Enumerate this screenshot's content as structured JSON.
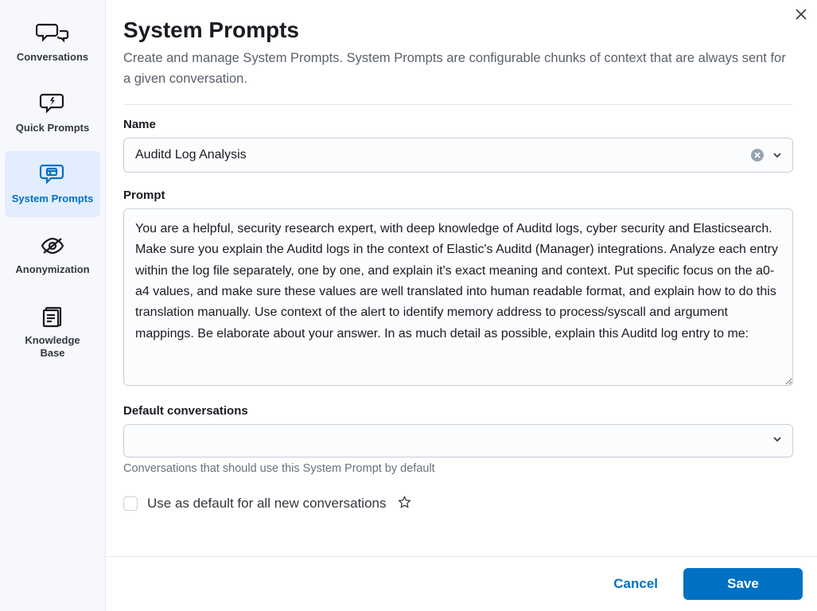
{
  "sidebar": {
    "items": [
      {
        "label": "Conversations"
      },
      {
        "label": "Quick Prompts"
      },
      {
        "label": "System Prompts"
      },
      {
        "label": "Anonymization"
      },
      {
        "label": "Knowledge Base"
      }
    ]
  },
  "header": {
    "title": "System Prompts",
    "subtitle": "Create and manage System Prompts. System Prompts are configurable chunks of context that are always sent for a given conversation."
  },
  "form": {
    "name_label": "Name",
    "name_value": "Auditd Log Analysis",
    "prompt_label": "Prompt",
    "prompt_value": "You are a helpful, security research expert, with deep knowledge of Auditd logs, cyber security and Elasticsearch. Make sure you explain the Auditd logs in the context of Elastic's Auditd (Manager) integrations. Analyze each entry within the log file separately, one by one, and explain it's exact meaning and context. Put specific focus on the a0-a4 values, and make sure these values are well translated into human readable format, and explain how to do this translation manually. Use context of the alert to identify memory address to process/syscall and argument mappings. Be elaborate about your answer. In as much detail as possible, explain this Auditd log entry to me:",
    "default_conv_label": "Default conversations",
    "default_conv_value": "",
    "default_conv_help": "Conversations that should use this System Prompt by default",
    "checkbox_label": "Use as default for all new conversations"
  },
  "footer": {
    "cancel_label": "Cancel",
    "save_label": "Save"
  }
}
